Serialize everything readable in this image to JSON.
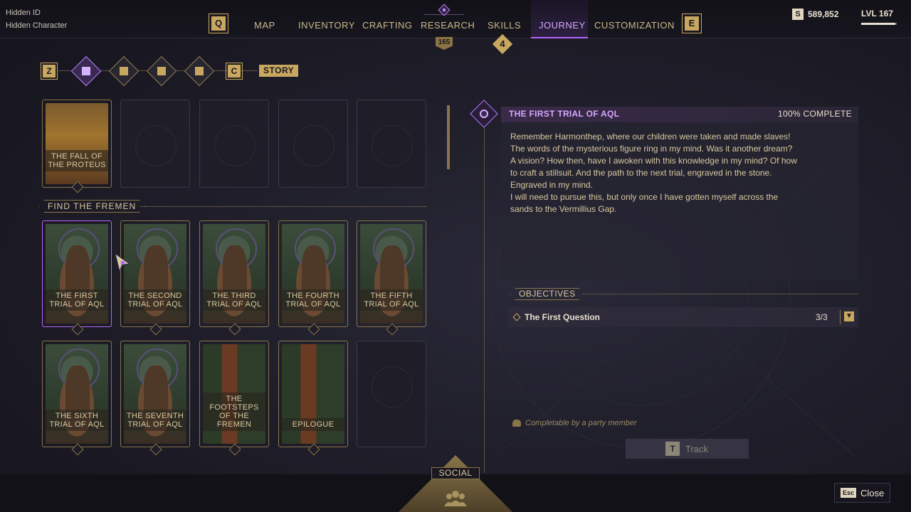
{
  "player": {
    "id": "Hidden ID",
    "character": "Hidden Character"
  },
  "nav": {
    "left_key": "Q",
    "right_key": "E",
    "tabs": [
      "MAP",
      "INVENTORY",
      "CRAFTING",
      "RESEARCH",
      "SKILLS",
      "JOURNEY",
      "CUSTOMIZATION"
    ],
    "active_tab": "JOURNEY",
    "research_badge": "165",
    "skills_badge": "4"
  },
  "currency": {
    "icon": "S",
    "amount": "589,852"
  },
  "level": {
    "label": "LVL 167",
    "progress": 0.95
  },
  "categories": {
    "left_key": "Z",
    "right_key": "C",
    "active_label": "STORY",
    "icons": [
      "bookmark-icon",
      "quill-icon",
      "book-icon",
      "pages-icon"
    ]
  },
  "cards_top": [
    {
      "label": "THE FALL OF THE PROTEUS",
      "art": "proteus",
      "done": true
    },
    {
      "label": "",
      "art": "empty"
    },
    {
      "label": "",
      "art": "empty"
    },
    {
      "label": "",
      "art": "empty"
    },
    {
      "label": "",
      "art": "empty"
    }
  ],
  "section": {
    "title": "FIND THE FREMEN"
  },
  "cards_row1": [
    {
      "label": "THE FIRST TRIAL OF AQL"
    },
    {
      "label": "THE SECOND TRIAL OF AQL"
    },
    {
      "label": "THE THIRD TRIAL OF AQL"
    },
    {
      "label": "THE FOURTH TRIAL OF AQL"
    },
    {
      "label": "THE FIFTH TRIAL OF AQL"
    }
  ],
  "cards_row2": [
    {
      "label": "THE SIXTH TRIAL OF AQL"
    },
    {
      "label": "THE SEVENTH TRIAL OF AQL"
    },
    {
      "label": "THE FOOTSTEPS OF THE FREMEN"
    },
    {
      "label": "EPILOGUE"
    }
  ],
  "detail": {
    "title": "THE FIRST TRIAL OF AQL",
    "completion": "100% COMPLETE",
    "description_lines": [
      "Remember Harmonthep, where our children were taken and made slaves!",
      "The words of the mysterious figure ring in my mind. Was it another dream?",
      "A vision? How then, have I awoken with this knowledge in my mind? Of how",
      "to craft a stillsuit. And the path to the next trial, engraved in the stone.",
      "Engraved in my mind.",
      "I will need to pursue this, but only once I have gotten myself across the",
      "sands to the Vermillius Gap."
    ],
    "objectives_label": "OBJECTIVES",
    "objective": {
      "name": "The First Question",
      "count": "3/3"
    },
    "party_note": "Completable by a party member",
    "track": {
      "key": "T",
      "label": "Track"
    }
  },
  "bottom": {
    "social_label": "SOCIAL",
    "close_key": "Esc",
    "close_label": "Close"
  },
  "colors": {
    "accent": "#b564ff",
    "gold": "#c8a860",
    "bg": "#1c1b26"
  }
}
